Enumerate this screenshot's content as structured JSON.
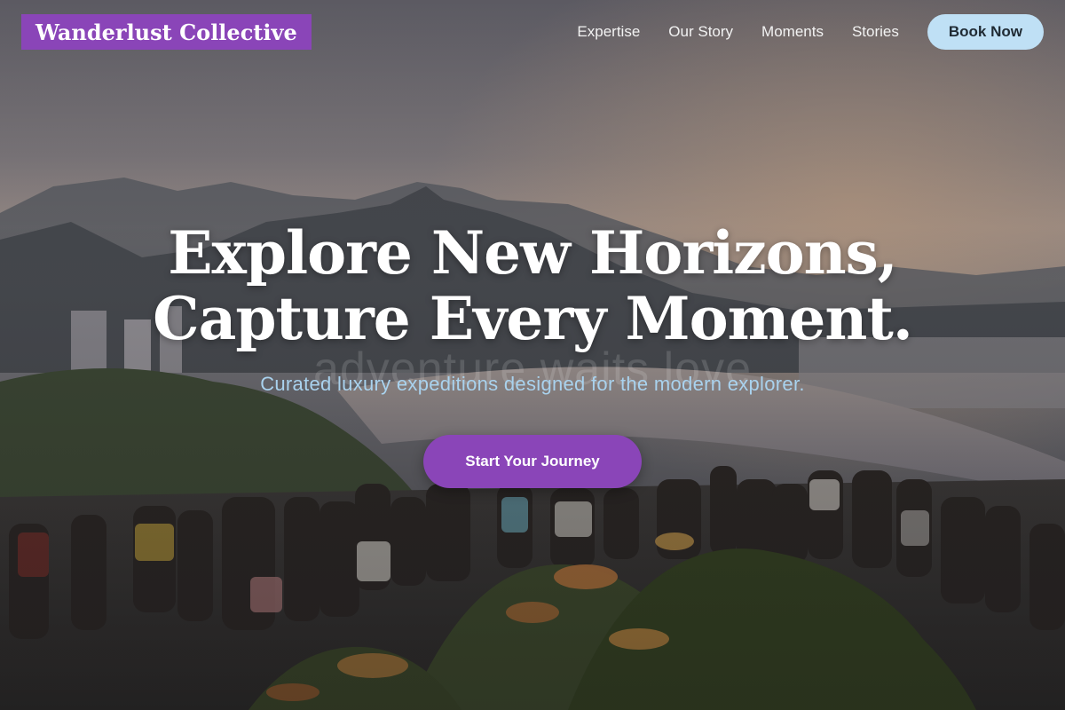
{
  "header": {
    "logo": "Wanderlust Collective",
    "nav": [
      {
        "label": "Expertise"
      },
      {
        "label": "Our Story"
      },
      {
        "label": "Moments"
      },
      {
        "label": "Stories"
      }
    ],
    "book_label": "Book Now"
  },
  "hero": {
    "headline_line1": "Explore New Horizons,",
    "headline_line2": "Capture Every Moment.",
    "watermark": "adventure waits love",
    "subtitle": "Curated luxury expeditions designed for the modern explorer.",
    "cta_label": "Start Your Journey"
  },
  "colors": {
    "brand": "#8a45b8",
    "book_button": "#bfe0f5",
    "subtitle": "#a9d2ee"
  }
}
